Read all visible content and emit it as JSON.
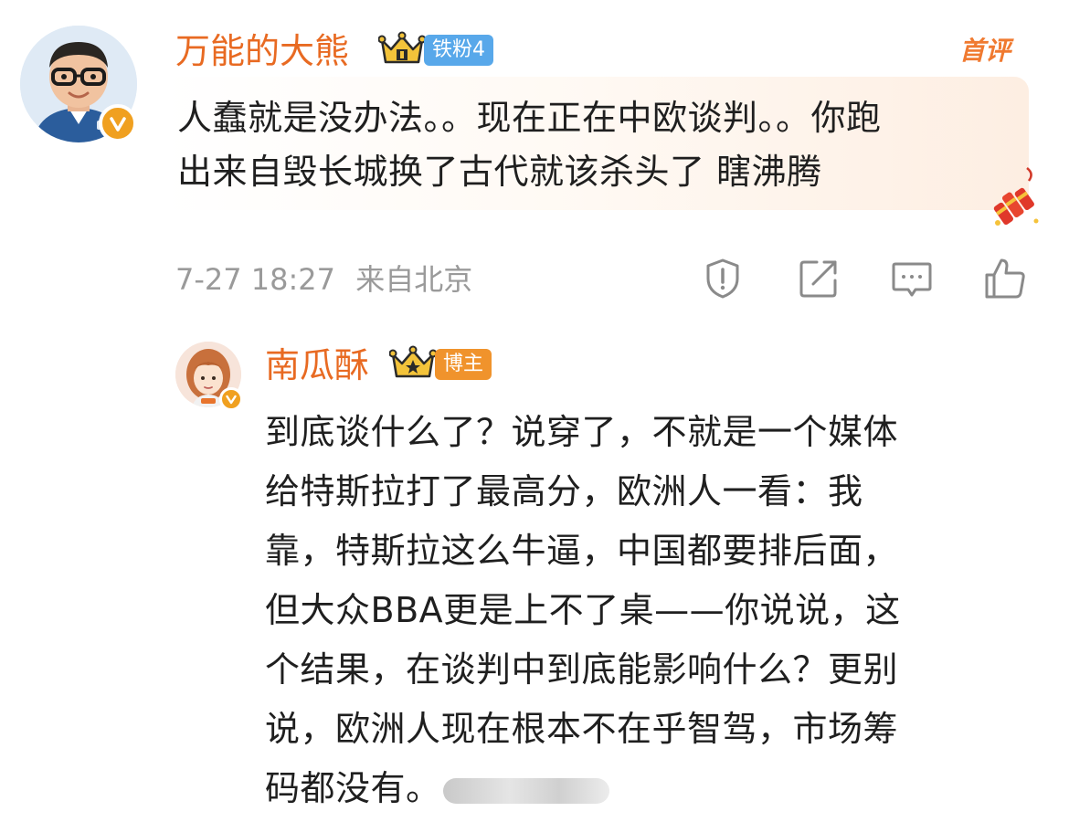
{
  "main_comment": {
    "username": "万能的大熊",
    "fan_badge": "铁粉4",
    "first_comment_tag": "首评",
    "text_lines": [
      "人蠢就是没办法。。现在正在中欧谈判。。你跑",
      "出来自毁长城换了古代就该杀头了 瞎沸腾"
    ],
    "timestamp": "7-27 18:27",
    "location": "来自北京",
    "actions": [
      "report-icon",
      "share-icon",
      "comment-icon",
      "like-icon"
    ]
  },
  "reply": {
    "username": "南瓜酥",
    "role_badge": "博主",
    "text_lines": [
      "到底谈什么了？说穿了，不就是一个媒体",
      "给特斯拉打了最高分，欧洲人一看：我",
      "靠，特斯拉这么牛逼，中国都要排后面，",
      "但大众BBA更是上不了桌——你说说，这",
      "个结果，在谈判中到底能影响什么？更别",
      "说，欧洲人现在根本不在乎智驾，市场筹",
      "码都没有。"
    ]
  },
  "colors": {
    "username": "#e86a22",
    "fan_badge_bg": "#58a8ea",
    "blogger_badge_bg": "#f0932c",
    "verified": "#f0a020",
    "meta_text": "#9a9a9a"
  }
}
